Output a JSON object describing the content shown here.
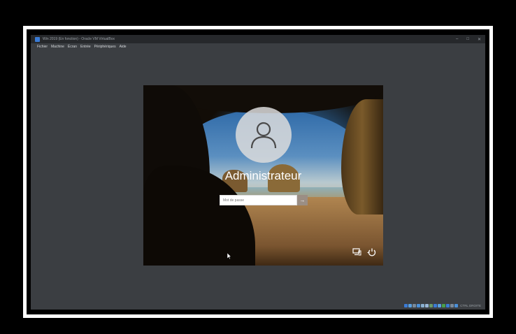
{
  "window": {
    "title": "Win 2019 (En fonction) - Oracle VM VirtualBox",
    "controls": [
      "–",
      "□",
      "✕"
    ]
  },
  "menu": {
    "items": [
      "Fichier",
      "Machine",
      "Écran",
      "Entrée",
      "Périphériques",
      "Aide"
    ]
  },
  "login": {
    "username": "Administrateur",
    "password_placeholder": "Mot de passe",
    "submit_glyph": "→",
    "avatar_icon": "user-icon"
  },
  "screen_icons": [
    "network-icon",
    "power-icon"
  ],
  "status_bar": {
    "host_key": "CTRL DROITE",
    "icons": [
      "#3a7bd5",
      "#5aa0e0",
      "#7a8a9a",
      "#4a90d9",
      "#8ab0d0",
      "#9ab8d8",
      "#6a9a6a",
      "#3a7bd5",
      "#5aa0e0",
      "#4aa04a",
      "#3a7bd5",
      "#7a8a9a",
      "#4a90d9"
    ]
  },
  "colors": {
    "vbox_background": "#3b3e42",
    "accent": "#3a7bd5"
  }
}
